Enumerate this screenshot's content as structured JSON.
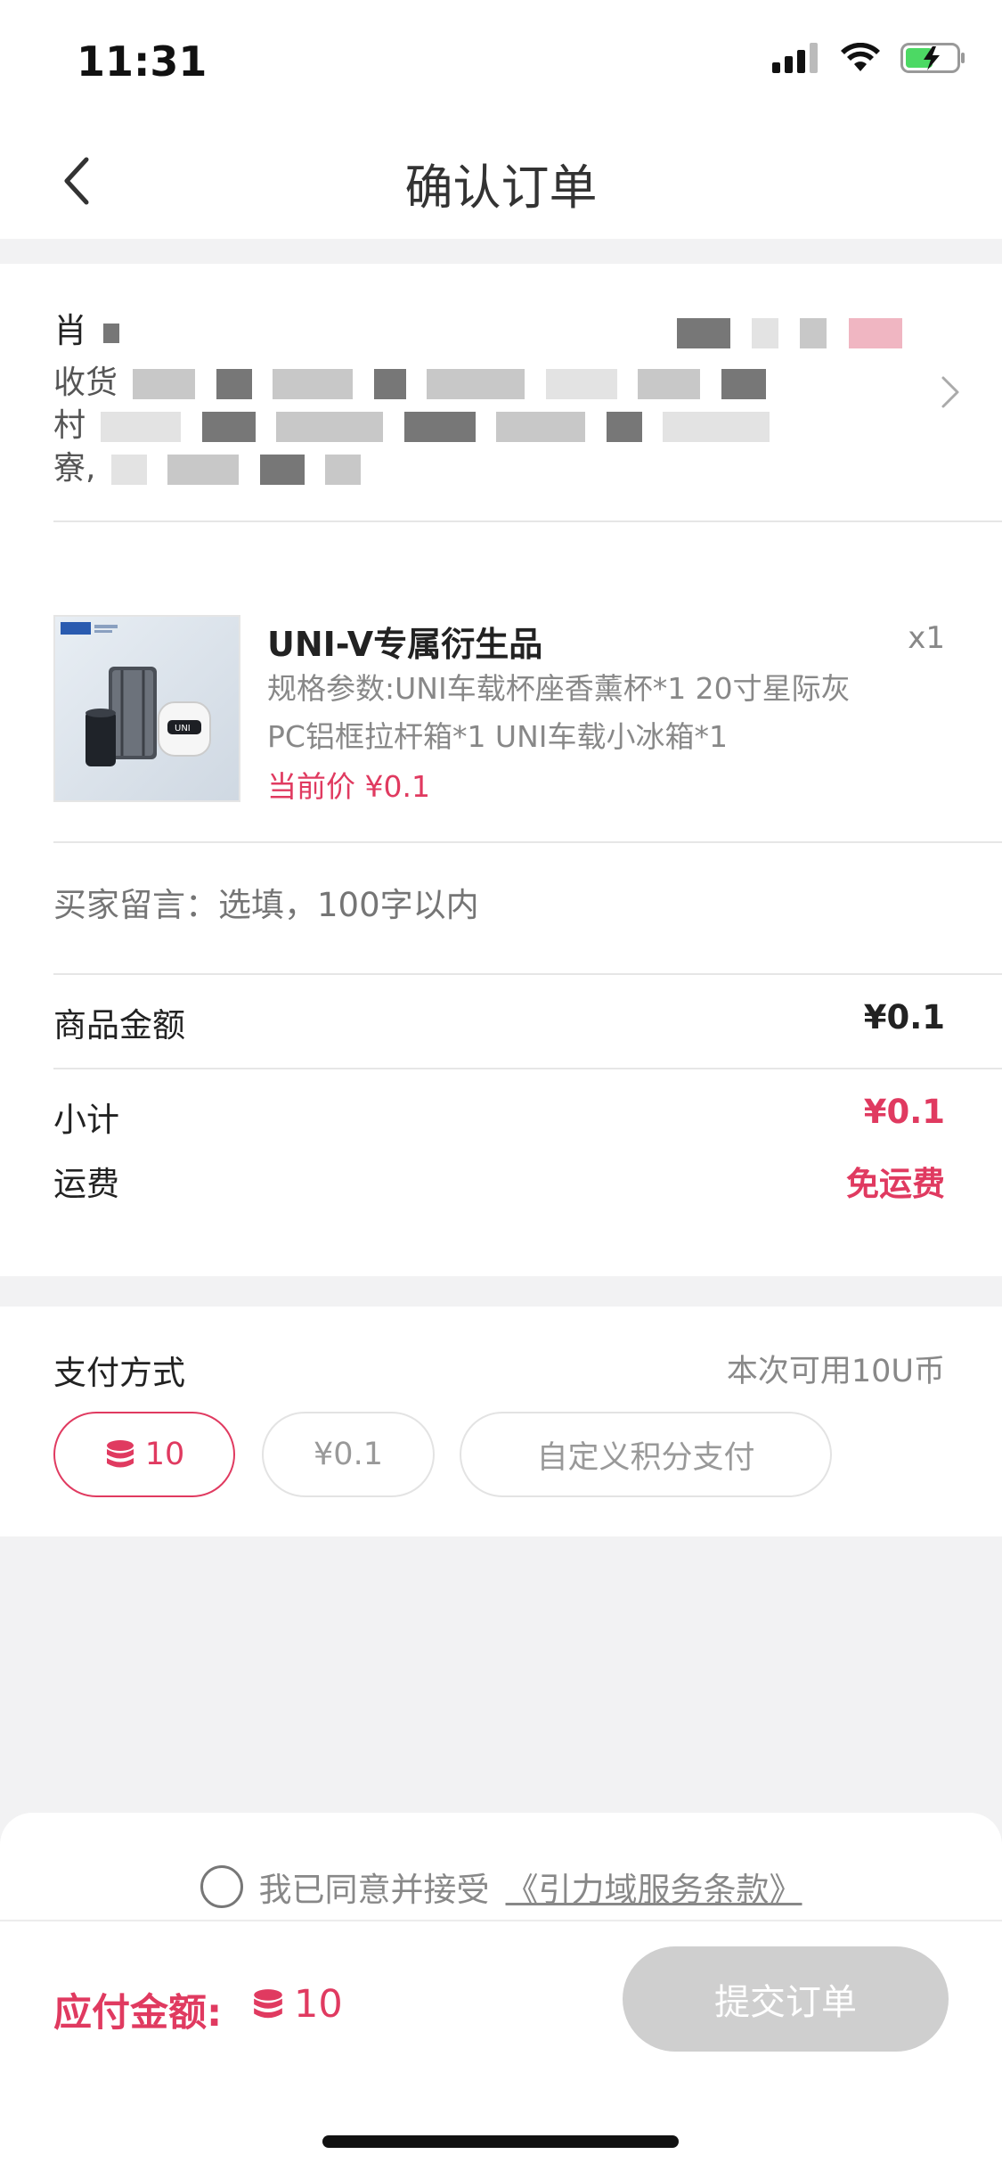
{
  "status_bar": {
    "time": "11:31"
  },
  "nav": {
    "title": "确认订单"
  },
  "address": {
    "name_char": "肖",
    "line1_prefix": "收货",
    "line2_prefix": "村",
    "line3_prefix": "寮,"
  },
  "product": {
    "name": "UNI-V专属衍生品",
    "qty": "x1",
    "spec": "规格参数:UNI车载杯座香薰杯*1 20寸星际灰PC铝框拉杆箱*1 UNI车载小冰箱*1",
    "price": "当前价 ¥0.1"
  },
  "buyer_note": {
    "placeholder": "买家留言：选填，100字以内"
  },
  "summary": {
    "goods_amount_label": "商品金额",
    "goods_amount_value": "¥0.1",
    "subtotal_label": "小计",
    "subtotal_value": "¥0.1",
    "shipping_label": "运费",
    "shipping_value": "免运费"
  },
  "payment": {
    "label": "支付方式",
    "available": "本次可用10U币",
    "options": [
      {
        "label": "10",
        "icon": "coin-stack-icon",
        "active": true
      },
      {
        "label": "¥0.1",
        "active": false
      },
      {
        "label": "自定义积分支付",
        "active": false
      }
    ]
  },
  "agreement": {
    "text": "我已同意并接受",
    "link": "《引力域服务条款》"
  },
  "footer": {
    "total_label": "应付金额:",
    "total_value": "10",
    "submit_label": "提交订单"
  },
  "colors": {
    "accent": "#e03a60",
    "disabled": "#cfcfcf"
  }
}
